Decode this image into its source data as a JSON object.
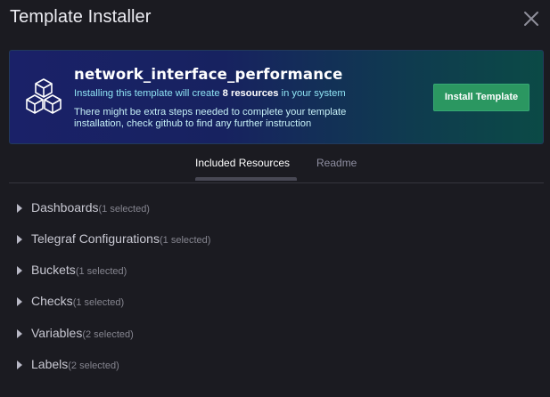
{
  "dialog": {
    "title": "Template Installer"
  },
  "banner": {
    "template_name": "network_interface_performance",
    "line1_prefix": "Installing this template will create ",
    "line1_count": "8 resources",
    "line1_suffix": " in your system",
    "line2": "There might be extra steps needed to complete your template installation, check github to find any further instruction",
    "install_label": "Install Template"
  },
  "tabs": [
    {
      "label": "Included Resources",
      "active": true
    },
    {
      "label": "Readme",
      "active": false
    }
  ],
  "resources": [
    {
      "name": "Dashboards",
      "count": "(1 selected)"
    },
    {
      "name": "Telegraf Configurations",
      "count": "(1 selected)"
    },
    {
      "name": "Buckets",
      "count": "(1 selected)"
    },
    {
      "name": "Checks",
      "count": "(1 selected)"
    },
    {
      "name": "Variables",
      "count": "(2 selected)"
    },
    {
      "name": "Labels",
      "count": "(2 selected)"
    }
  ],
  "colors": {
    "accent_green": "#2b9761",
    "banner_text": "#8fe3f3"
  },
  "icons": {
    "close": "close-icon",
    "template": "cubes-icon",
    "expand": "caret-right-icon"
  }
}
